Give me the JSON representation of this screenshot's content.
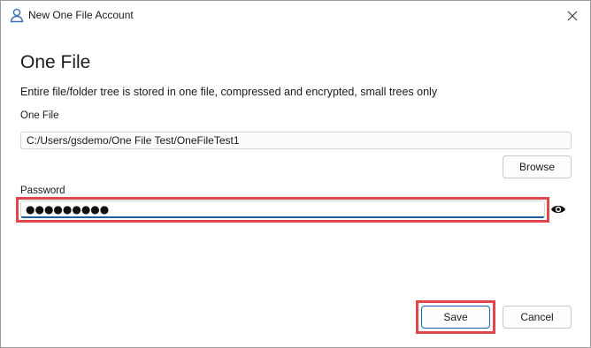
{
  "window": {
    "title": "New One File Account",
    "title_icon": "user-icon",
    "close_icon": "close-icon"
  },
  "heading": "One File",
  "description": "Entire file/folder tree is stored in one file, compressed and encrypted, small trees only",
  "file_field": {
    "label": "One File",
    "value": "C:/Users/gsdemo/One File Test/OneFileTest1"
  },
  "browse_button": {
    "label": "Browse"
  },
  "password_field": {
    "label": "Password",
    "value": "●●●●●●●●●",
    "reveal_icon": "eye-icon"
  },
  "footer": {
    "save_label": "Save",
    "cancel_label": "Cancel"
  },
  "colors": {
    "highlight": "#e0474c",
    "focus_underline": "#1f5ca8"
  }
}
